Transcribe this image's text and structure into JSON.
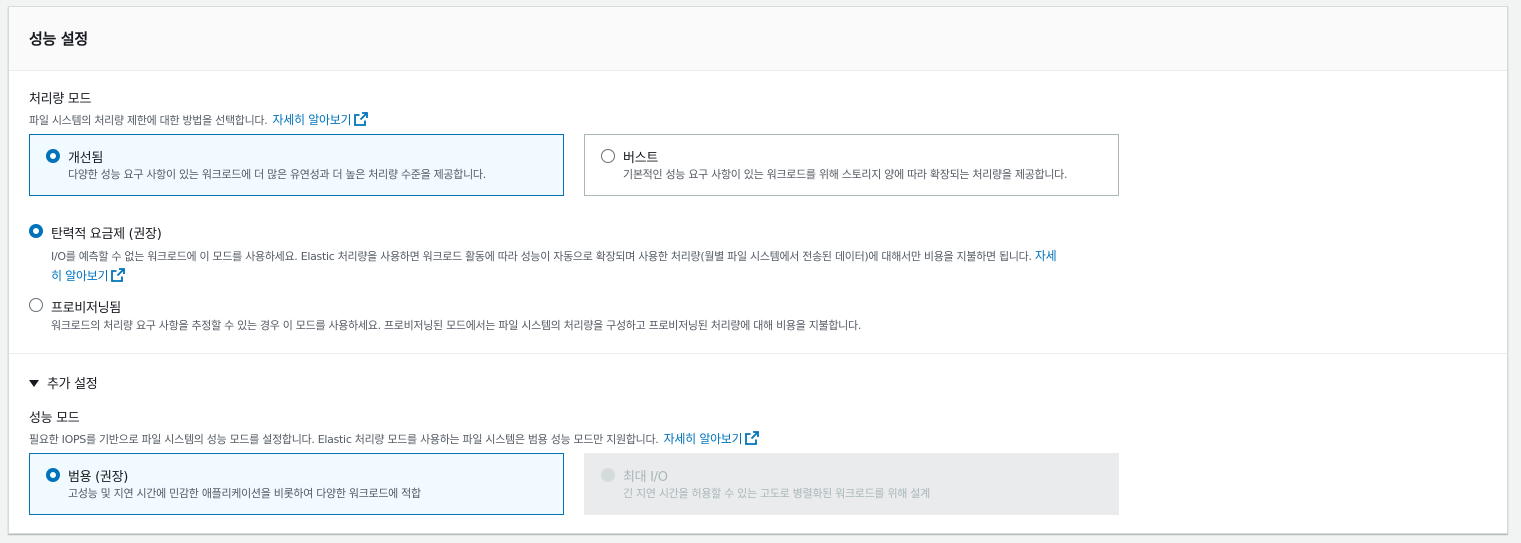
{
  "section": {
    "title": "성능 설정"
  },
  "throughput": {
    "label": "처리량 모드",
    "description": "파일 시스템의 처리량 제한에 대한 방법을 선택합니다.",
    "learn_more": "자세히 알아보기",
    "tiles": [
      {
        "title": "개선됨",
        "description": "다양한 성능 요구 사항이 있는 워크로드에 더 많은 유연성과 더 높은 처리량 수준을 제공합니다.",
        "selected": true
      },
      {
        "title": "버스트",
        "description": "기본적인 성능 요구 사항이 있는 워크로드를 위해 스토리지 양에 따라 확장되는 처리량을 제공합니다.",
        "selected": false
      }
    ],
    "options": [
      {
        "title": "탄력적 요금제 (권장)",
        "description": "I/O를 예측할 수 없는 워크로드에 이 모드를 사용하세요. Elastic 처리량을 사용하면 워크로드 활동에 따라 성능이 자동으로 확장되며 사용한 처리량(월별 파일 시스템에서 전송된 데이터)에 대해서만 비용을 지불하면 됩니다.",
        "link_part1": "자세",
        "link_part2": "히 알아보기",
        "selected": true
      },
      {
        "title": "프로비저닝됨",
        "description": "워크로드의 처리량 요구 사항을 추정할 수 있는 경우 이 모드를 사용하세요. 프로비저닝된 모드에서는 파일 시스템의 처리량을 구성하고 프로비저닝된 처리량에 대해 비용을 지불합니다.",
        "selected": false
      }
    ]
  },
  "additional": {
    "toggle_label": "추가 설정",
    "performance_mode": {
      "label": "성능 모드",
      "description": "필요한 IOPS를 기반으로 파일 시스템의 성능 모드를 설정합니다. Elastic 처리량 모드를 사용하는 파일 시스템은 범용 성능 모드만 지원합니다.",
      "learn_more": "자세히 알아보기",
      "tiles": [
        {
          "title": "범용 (권장)",
          "description": "고성능 및 지연 시간에 민감한 애플리케이션을 비롯하여 다양한 워크로드에 적합",
          "selected": true,
          "disabled": false
        },
        {
          "title": "최대 I/O",
          "description": "긴 지연 시간을 허용할 수 있는 고도로 병렬화된 워크로드를 위해 설계",
          "selected": false,
          "disabled": true
        }
      ]
    }
  },
  "colors": {
    "accent": "#0073bb",
    "selected_bg": "#f1faff",
    "disabled_bg": "#e9ebed"
  }
}
